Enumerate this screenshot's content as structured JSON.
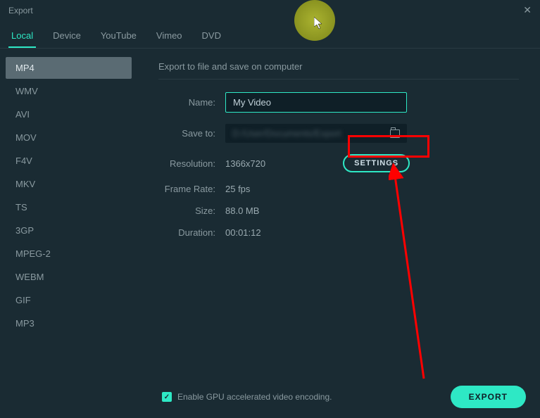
{
  "window": {
    "title": "Export"
  },
  "tabs": [
    {
      "label": "Local",
      "active": true
    },
    {
      "label": "Device",
      "active": false
    },
    {
      "label": "YouTube",
      "active": false
    },
    {
      "label": "Vimeo",
      "active": false
    },
    {
      "label": "DVD",
      "active": false
    }
  ],
  "formats": [
    {
      "label": "MP4",
      "active": true
    },
    {
      "label": "WMV",
      "active": false
    },
    {
      "label": "AVI",
      "active": false
    },
    {
      "label": "MOV",
      "active": false
    },
    {
      "label": "F4V",
      "active": false
    },
    {
      "label": "MKV",
      "active": false
    },
    {
      "label": "TS",
      "active": false
    },
    {
      "label": "3GP",
      "active": false
    },
    {
      "label": "MPEG-2",
      "active": false
    },
    {
      "label": "WEBM",
      "active": false
    },
    {
      "label": "GIF",
      "active": false
    },
    {
      "label": "MP3",
      "active": false
    }
  ],
  "main": {
    "title": "Export to file and save on computer",
    "name_label": "Name:",
    "name_value": "My Video",
    "saveto_label": "Save to:",
    "saveto_value": "D:/User/Documents/Export",
    "resolution_label": "Resolution:",
    "resolution_value": "1366x720",
    "settings_label": "SETTINGS",
    "framerate_label": "Frame Rate:",
    "framerate_value": "25 fps",
    "size_label": "Size:",
    "size_value": "88.0 MB",
    "duration_label": "Duration:",
    "duration_value": "00:01:12"
  },
  "footer": {
    "gpu_label": "Enable GPU accelerated video encoding.",
    "gpu_checked": true,
    "export_label": "EXPORT"
  }
}
